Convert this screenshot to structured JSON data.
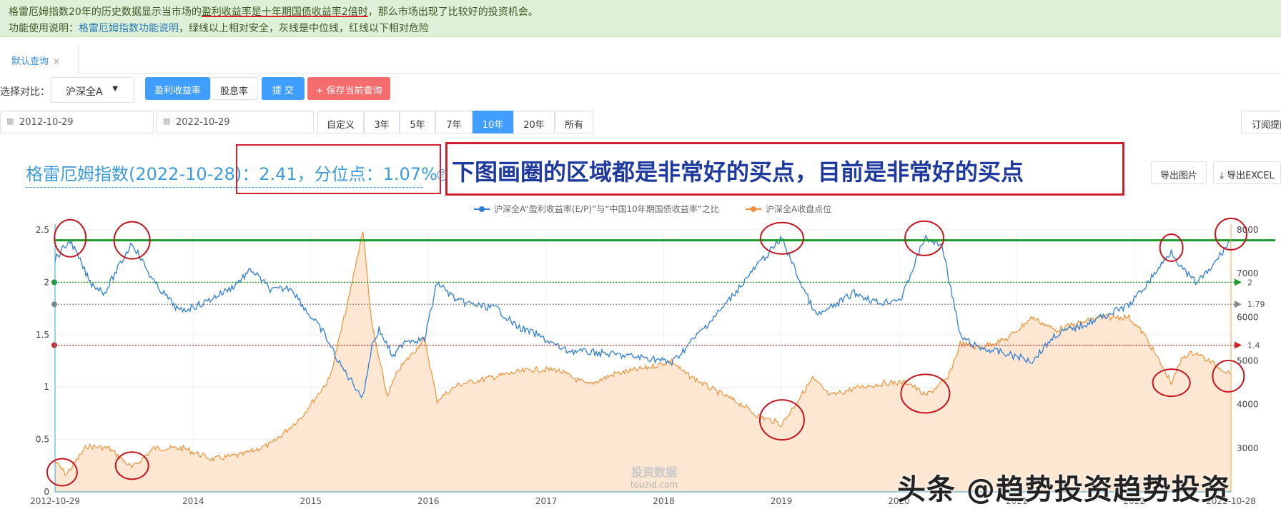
{
  "notice": {
    "line1_a": "格雷厄姆指数20年的历史数据显示当市场的",
    "line1_b": "盈利收益率是十年期国债收益率2倍时",
    "line1_c": "，那么市场出现了比较好的投资机会。",
    "line2_a": "功能使用说明：",
    "line2_link": "格雷厄姆指数功能说明",
    "line2_b": "，绿线以上相对安全，灰线是中位线，红线以下相对危险"
  },
  "tab": {
    "label": "默认查询",
    "close": "×"
  },
  "controls": {
    "compare_label": "选择对比：",
    "compare_value": "沪深全A",
    "seg_earnings": "盈利收益率",
    "seg_dividend": "股息率",
    "submit": "提 交",
    "save": "+ 保存当前查询",
    "start_date": "2012-10-29",
    "end_date": "2022-10-29",
    "ranges": [
      "自定义",
      "3年",
      "5年",
      "7年",
      "10年",
      "20年",
      "所有"
    ],
    "active_range": "10年",
    "subscribe": "订阅提醒",
    "export_image": "导出图片",
    "export_excel": "导出EXCEL"
  },
  "headline": {
    "title": "格雷厄姆指数(2022-10-28)：",
    "value": "2.41，分位点：1.07%",
    "help": "?"
  },
  "annotation": "下图画圈的区域都是非常好的买点，目前是非常好的买点",
  "watermark": "头条 @趋势投资趋势投资",
  "colors": {
    "green_line": "#1a9a2a",
    "gray_line": "#888888",
    "red_line": "#d42020",
    "graham": "#2f7ed8",
    "index": "#f0923a",
    "area": "#fde7d2",
    "circle": "#c41620"
  },
  "chart_data": {
    "type": "line",
    "legend": [
      "沪深全A“盈利收益率(E/P)”与“中国10年期国债收益率”之比",
      "沪深全A收盘点位"
    ],
    "x_ticks": [
      "2012-10-29",
      "2014",
      "2015",
      "2016",
      "2017",
      "2018",
      "2019",
      "2020",
      "2021",
      "2022",
      "2022-10-28"
    ],
    "left_axis": {
      "ticks": [
        0,
        0.5,
        1,
        1.5,
        2,
        2.5
      ],
      "range": [
        0,
        2.5
      ]
    },
    "right_axis": {
      "ticks": [
        3000,
        4000,
        5000,
        6000,
        7000,
        8000
      ],
      "range": [
        2000,
        8000
      ]
    },
    "reference_lines": [
      {
        "value": 2,
        "label": "2",
        "color": "#1a9a2a"
      },
      {
        "value": 1.79,
        "label": "1.79",
        "color": "#888888"
      },
      {
        "value": 1.4,
        "label": "1.4",
        "color": "#d42020"
      }
    ],
    "threshold_line": {
      "value": 2.4,
      "color": "#1a9a2a"
    },
    "series": [
      {
        "name": "沪深全A“盈利收益率(E/P)”与“中国10年期国债收益率”之比",
        "axis": "left",
        "points": [
          [
            "2012-10-29",
            2.22
          ],
          [
            "2012-12-15",
            2.4
          ],
          [
            "2013-02-15",
            2.0
          ],
          [
            "2013-04-01",
            1.9
          ],
          [
            "2013-06-25",
            2.38
          ],
          [
            "2013-09-01",
            2.0
          ],
          [
            "2013-11-20",
            1.72
          ],
          [
            "2014-02-01",
            1.8
          ],
          [
            "2014-05-01",
            1.95
          ],
          [
            "2014-07-01",
            2.12
          ],
          [
            "2014-09-01",
            1.92
          ],
          [
            "2014-11-01",
            1.95
          ],
          [
            "2014-12-20",
            1.72
          ],
          [
            "2015-02-10",
            1.52
          ],
          [
            "2015-04-01",
            1.22
          ],
          [
            "2015-06-12",
            0.9
          ],
          [
            "2015-07-10",
            1.4
          ],
          [
            "2015-08-01",
            1.55
          ],
          [
            "2015-09-15",
            1.28
          ],
          [
            "2015-10-20",
            1.45
          ],
          [
            "2015-12-20",
            1.45
          ],
          [
            "2016-01-28",
            2.0
          ],
          [
            "2016-04-01",
            1.82
          ],
          [
            "2016-06-01",
            1.78
          ],
          [
            "2016-08-01",
            1.75
          ],
          [
            "2016-10-01",
            1.58
          ],
          [
            "2016-12-01",
            1.5
          ],
          [
            "2017-03-01",
            1.35
          ],
          [
            "2017-06-01",
            1.33
          ],
          [
            "2017-09-01",
            1.3
          ],
          [
            "2017-12-01",
            1.27
          ],
          [
            "2018-01-26",
            1.23
          ],
          [
            "2018-04-01",
            1.45
          ],
          [
            "2018-07-01",
            1.75
          ],
          [
            "2018-10-15",
            2.15
          ],
          [
            "2019-01-03",
            2.42
          ],
          [
            "2019-03-01",
            2.0
          ],
          [
            "2019-04-20",
            1.68
          ],
          [
            "2019-06-01",
            1.75
          ],
          [
            "2019-08-15",
            1.9
          ],
          [
            "2019-11-01",
            1.8
          ],
          [
            "2020-01-10",
            1.85
          ],
          [
            "2020-03-20",
            2.42
          ],
          [
            "2020-05-15",
            2.35
          ],
          [
            "2020-07-10",
            1.48
          ],
          [
            "2020-09-01",
            1.38
          ],
          [
            "2020-11-15",
            1.33
          ],
          [
            "2021-02-18",
            1.25
          ],
          [
            "2021-05-01",
            1.5
          ],
          [
            "2021-08-01",
            1.6
          ],
          [
            "2021-10-01",
            1.68
          ],
          [
            "2021-12-15",
            1.78
          ],
          [
            "2022-02-01",
            1.95
          ],
          [
            "2022-04-26",
            2.3
          ],
          [
            "2022-06-01",
            2.12
          ],
          [
            "2022-07-10",
            2.0
          ],
          [
            "2022-08-20",
            2.1
          ],
          [
            "2022-10-28",
            2.41
          ]
        ]
      },
      {
        "name": "沪深全A收盘点位",
        "axis": "right",
        "points": [
          [
            "2012-10-29",
            2700
          ],
          [
            "2012-12-03",
            2400
          ],
          [
            "2013-02-05",
            3050
          ],
          [
            "2013-04-15",
            3000
          ],
          [
            "2013-06-25",
            2550
          ],
          [
            "2013-09-01",
            3000
          ],
          [
            "2013-12-01",
            3000
          ],
          [
            "2014-03-01",
            2750
          ],
          [
            "2014-06-01",
            2850
          ],
          [
            "2014-09-01",
            3100
          ],
          [
            "2014-12-01",
            3700
          ],
          [
            "2015-03-01",
            4600
          ],
          [
            "2015-05-01",
            6500
          ],
          [
            "2015-06-12",
            8000
          ],
          [
            "2015-07-10",
            5800
          ],
          [
            "2015-08-26",
            4200
          ],
          [
            "2015-10-01",
            4800
          ],
          [
            "2015-12-20",
            5500
          ],
          [
            "2016-01-28",
            4100
          ],
          [
            "2016-04-01",
            4450
          ],
          [
            "2016-08-01",
            4650
          ],
          [
            "2016-11-15",
            4800
          ],
          [
            "2017-02-01",
            4800
          ],
          [
            "2017-05-10",
            4450
          ],
          [
            "2017-08-01",
            4700
          ],
          [
            "2017-11-15",
            4850
          ],
          [
            "2018-01-26",
            5000
          ],
          [
            "2018-03-01",
            4750
          ],
          [
            "2018-06-01",
            4350
          ],
          [
            "2018-09-01",
            4000
          ],
          [
            "2018-10-18",
            3750
          ],
          [
            "2019-01-03",
            3550
          ],
          [
            "2019-04-08",
            4600
          ],
          [
            "2019-06-01",
            4200
          ],
          [
            "2019-09-01",
            4400
          ],
          [
            "2019-12-01",
            4500
          ],
          [
            "2020-02-01",
            4500
          ],
          [
            "2020-03-23",
            4200
          ],
          [
            "2020-06-01",
            4600
          ],
          [
            "2020-07-10",
            5400
          ],
          [
            "2020-09-01",
            5300
          ],
          [
            "2020-12-01",
            5500
          ],
          [
            "2021-02-18",
            6000
          ],
          [
            "2021-05-01",
            5700
          ],
          [
            "2021-09-15",
            6000
          ],
          [
            "2021-12-15",
            6000
          ],
          [
            "2022-02-01",
            5600
          ],
          [
            "2022-04-26",
            4500
          ],
          [
            "2022-06-01",
            5100
          ],
          [
            "2022-07-10",
            5200
          ],
          [
            "2022-08-20",
            5000
          ],
          [
            "2022-10-28",
            4700
          ]
        ]
      }
    ],
    "brand_label": "投资数据",
    "brand_url": "touzid.com"
  }
}
